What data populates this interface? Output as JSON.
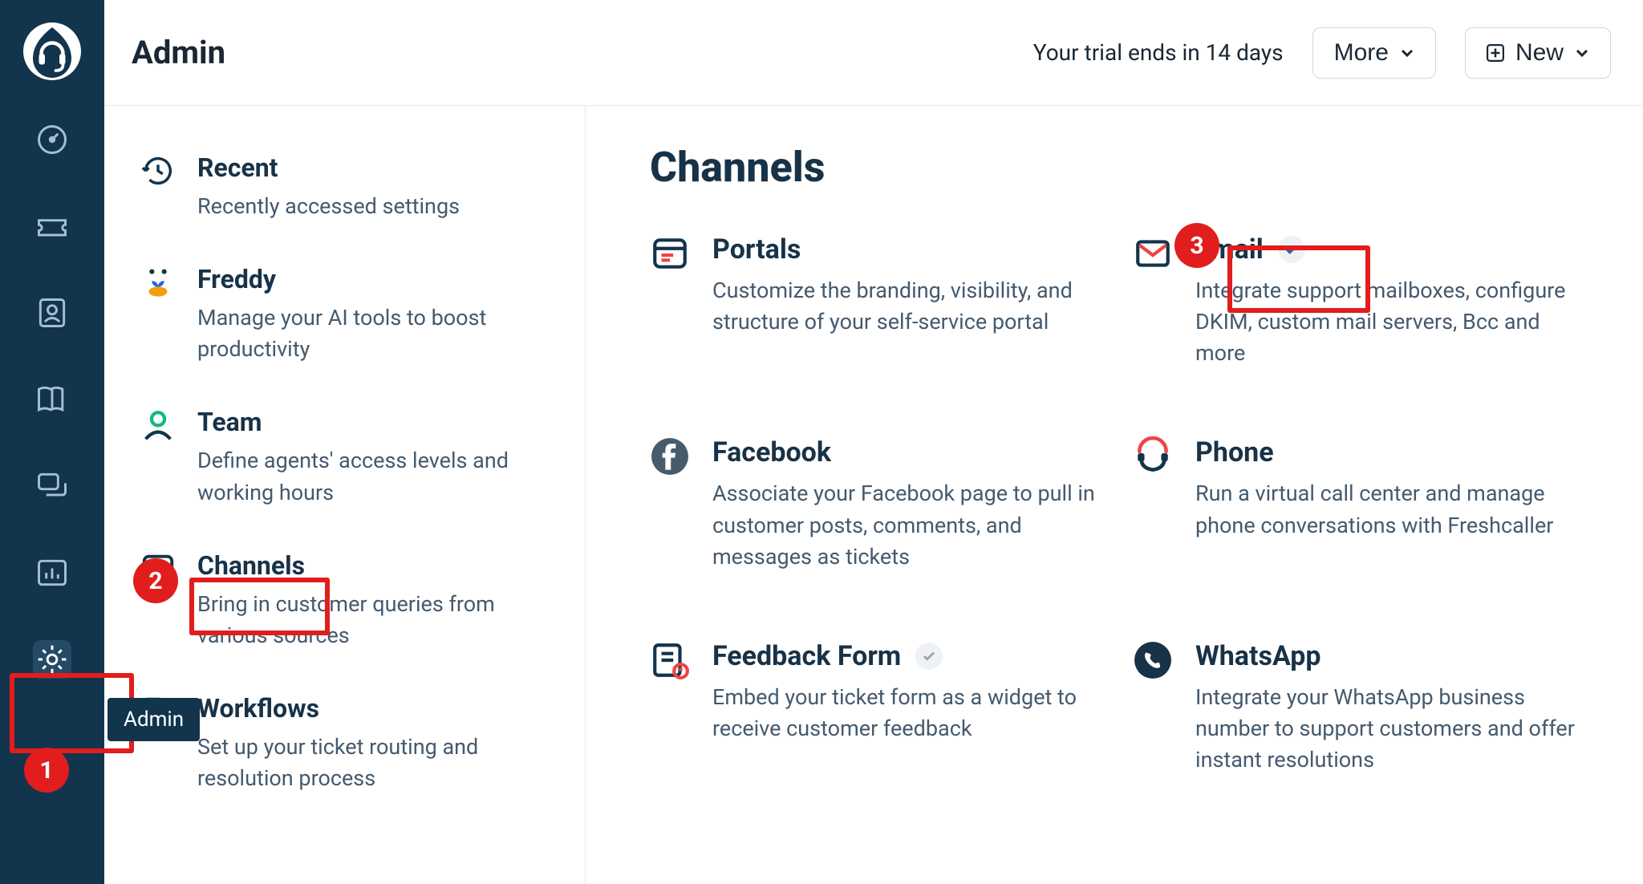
{
  "header": {
    "title": "Admin",
    "trial_text": "Your trial ends in 14 days",
    "more_label": "More",
    "new_label": "New"
  },
  "rail_tooltip": "Admin",
  "sidebar": {
    "items": [
      {
        "icon": "recent",
        "title": "Recent",
        "desc": "Recently accessed settings"
      },
      {
        "icon": "freddy",
        "title": "Freddy",
        "desc": "Manage your AI tools to boost productivity"
      },
      {
        "icon": "team",
        "title": "Team",
        "desc": "Define agents' access levels and working hours"
      },
      {
        "icon": "channels",
        "title": "Channels",
        "desc": "Bring in customer queries from various sources"
      },
      {
        "icon": "workflows",
        "title": "Workflows",
        "desc": "Set up your ticket routing and resolution process"
      }
    ]
  },
  "main": {
    "heading": "Channels",
    "cards": [
      {
        "icon": "portals",
        "title": "Portals",
        "desc": "Customize the branding, visibility, and structure of your self-service portal"
      },
      {
        "icon": "email",
        "title": "Email",
        "desc": "Integrate support mailboxes, configure DKIM, custom mail servers, Bcc and more",
        "chip": true
      },
      {
        "icon": "facebook",
        "title": "Facebook",
        "desc": "Associate your Facebook page to pull in customer posts, comments, and messages as tickets"
      },
      {
        "icon": "phone",
        "title": "Phone",
        "desc": "Run a virtual call center and manage phone conversations with Freshcaller"
      },
      {
        "icon": "feedback",
        "title": "Feedback Form",
        "desc": "Embed your ticket form as a widget to receive customer feedback",
        "chip": true
      },
      {
        "icon": "whatsapp",
        "title": "WhatsApp",
        "desc": "Integrate your WhatsApp business number to support customers and offer instant resolutions"
      }
    ]
  },
  "callouts": {
    "one": "1",
    "two": "2",
    "three": "3"
  }
}
